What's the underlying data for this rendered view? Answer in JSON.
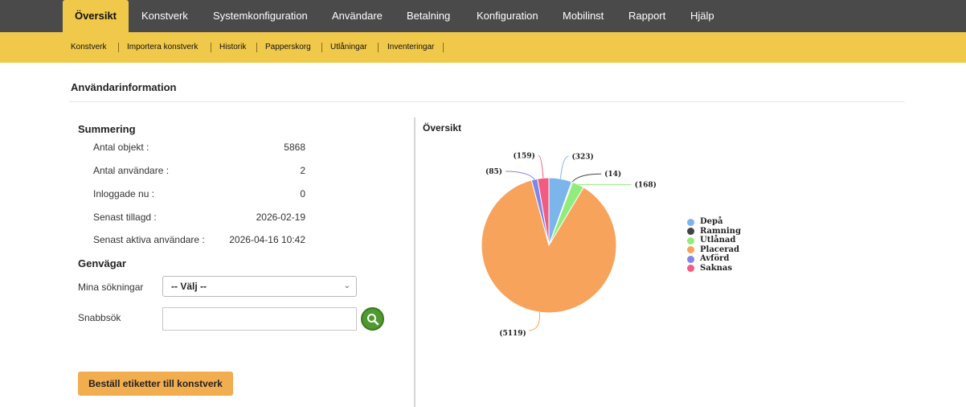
{
  "nav": {
    "tabs": [
      {
        "label": "Översikt",
        "active": true
      },
      {
        "label": "Konstverk"
      },
      {
        "label": "Systemkonfiguration"
      },
      {
        "label": "Användare"
      },
      {
        "label": "Betalning"
      },
      {
        "label": "Konfiguration"
      },
      {
        "label": "Mobilinst"
      },
      {
        "label": "Rapport"
      },
      {
        "label": "Hjälp"
      }
    ],
    "subtabs": [
      "Konstverk",
      "Importera konstverk",
      "Historik",
      "Papperskorg",
      "Utlåningar",
      "Inventeringar"
    ]
  },
  "page": {
    "title": "Användarinformation"
  },
  "summary": {
    "heading": "Summering",
    "rows": [
      {
        "label": "Antal objekt :",
        "value": "5868"
      },
      {
        "label": "Antal användare :",
        "value": "2"
      },
      {
        "label": "Inloggade nu :",
        "value": "0"
      },
      {
        "label": "Senast tillagd :",
        "value": "2026-02-19"
      },
      {
        "label": "Senast aktiva användare :",
        "value": "2026-04-16 10:42"
      }
    ]
  },
  "shortcuts": {
    "heading": "Genvägar",
    "my_searches_label": "Mina sökningar",
    "my_searches_value": "-- Välj --",
    "quick_search_label": "Snabbsök",
    "quick_search_value": "",
    "search_icon": "magnifier-icon"
  },
  "order_button": "Beställ etiketter till konstverk",
  "chart_data": {
    "type": "pie",
    "title": "Översikt",
    "legend_position": "right",
    "series": [
      {
        "name": "Depå",
        "value": 323,
        "color": "#7cb5ec"
      },
      {
        "name": "Ramning",
        "value": 14,
        "color": "#434348"
      },
      {
        "name": "Utlånad",
        "value": 168,
        "color": "#90ed7d"
      },
      {
        "name": "Placerad",
        "value": 5119,
        "color": "#f7a35c"
      },
      {
        "name": "Avförd",
        "value": 85,
        "color": "#8085e9"
      },
      {
        "name": "Saknas",
        "value": 159,
        "color": "#f15c80"
      }
    ]
  }
}
